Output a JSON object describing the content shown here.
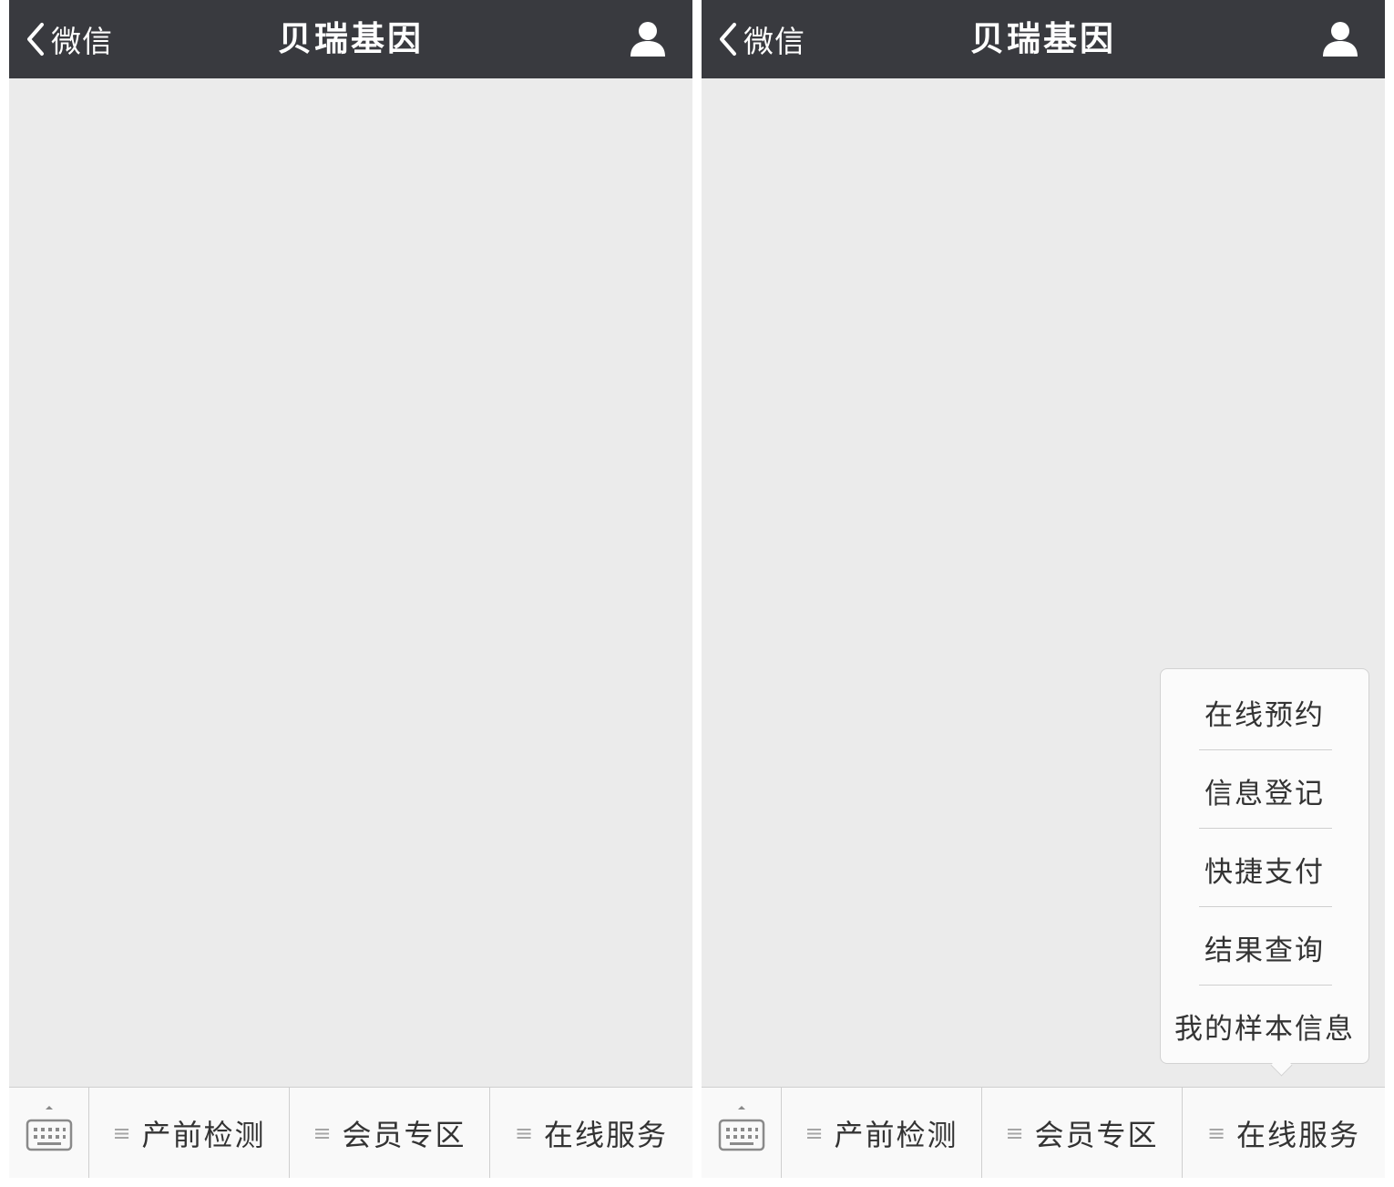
{
  "screens": [
    {
      "navbar": {
        "back_label": "微信",
        "title": "贝瑞基因"
      },
      "menubar": {
        "tabs": [
          {
            "label": "产前检测"
          },
          {
            "label": "会员专区"
          },
          {
            "label": "在线服务"
          }
        ]
      }
    },
    {
      "navbar": {
        "back_label": "微信",
        "title": "贝瑞基因"
      },
      "menubar": {
        "tabs": [
          {
            "label": "产前检测"
          },
          {
            "label": "会员专区"
          },
          {
            "label": "在线服务"
          }
        ]
      },
      "submenu": {
        "parent_tab": "在线服务",
        "items": [
          {
            "label": "在线预约"
          },
          {
            "label": "信息登记"
          },
          {
            "label": "快捷支付"
          },
          {
            "label": "结果查询"
          },
          {
            "label": "我的样本信息"
          }
        ]
      }
    }
  ],
  "icons": {
    "back": "chevron-left-icon",
    "profile": "person-icon",
    "keyboard": "keyboard-icon",
    "tab_menu": "menu-lines-icon"
  },
  "colors": {
    "navbar_bg": "#393a3f",
    "content_bg": "#ebebeb",
    "menubar_bg": "#f9f9f9",
    "text_primary": "#333333"
  }
}
